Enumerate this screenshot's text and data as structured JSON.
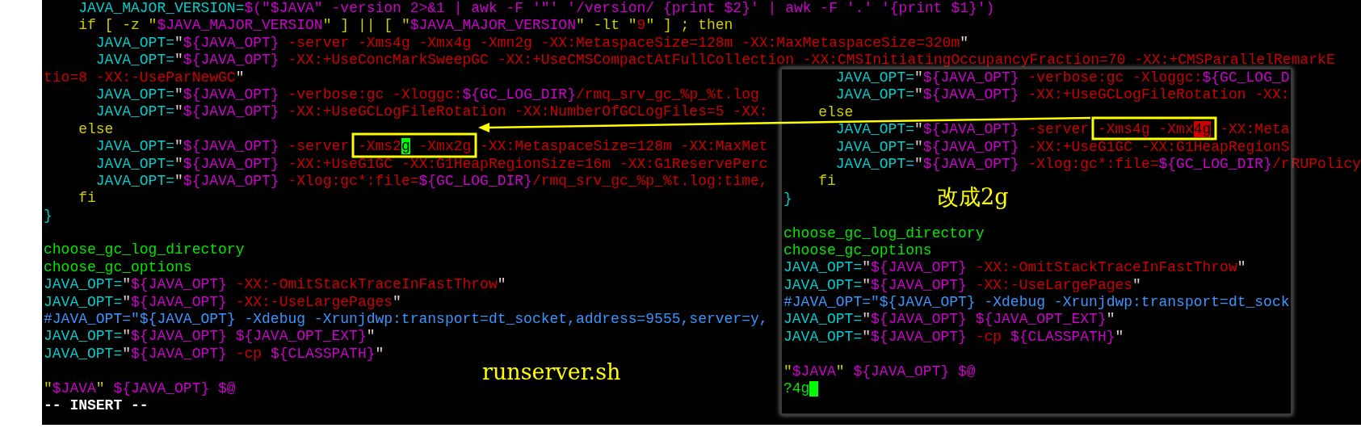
{
  "editor": {
    "lines": [
      {
        "kind": "code",
        "segments": [
          {
            "kind": "variable",
            "text": "    JAVA_MAJOR_VERSION="
          },
          {
            "kind": "expansion",
            "text": "$(\"$JAVA\" -version 2>&1 | awk -F '\"' '/version/ {print $2}' | awk -F '.' '{print $1}')"
          }
        ]
      },
      {
        "kind": "code",
        "segments": [
          {
            "kind": "keyword",
            "text": "    if [ -z \""
          },
          {
            "kind": "expansion",
            "text": "$JAVA_MAJOR_VERSION"
          },
          {
            "kind": "keyword",
            "text": "\" ] || [ \""
          },
          {
            "kind": "expansion",
            "text": "$JAVA_MAJOR_VERSION"
          },
          {
            "kind": "keyword",
            "text": "\" -lt \""
          },
          {
            "kind": "option",
            "text": "9"
          },
          {
            "kind": "keyword",
            "text": "\" ] ; then"
          }
        ]
      },
      {
        "kind": "code",
        "segments": [
          {
            "kind": "variable",
            "text": "      JAVA_OPT="
          },
          {
            "kind": "quote",
            "text": "\""
          },
          {
            "kind": "expansion",
            "text": "${JAVA_OPT}"
          },
          {
            "kind": "option",
            "text": " -server -Xms4g -Xmx4g -Xmn2g -XX:MetaspaceSize=128m -XX:MaxMetaspaceSize=320m"
          },
          {
            "kind": "quote",
            "text": "\""
          }
        ]
      },
      {
        "kind": "code",
        "segments": [
          {
            "kind": "variable",
            "text": "      JAVA_OPT="
          },
          {
            "kind": "quote",
            "text": "\""
          },
          {
            "kind": "expansion",
            "text": "${JAVA_OPT}"
          },
          {
            "kind": "option",
            "text": " -XX:+UseConcMarkSweepGC -XX:+UseCMSCompactAtFullCollection -XX:CMSInitiatingOccupancyFraction=70 -XX:+CMSParallelRemarkE"
          }
        ]
      },
      {
        "kind": "code",
        "segments": [
          {
            "kind": "option",
            "text": "tio=8 -XX:-UseParNewGC"
          },
          {
            "kind": "quote",
            "text": "\""
          }
        ]
      },
      {
        "kind": "code",
        "segments": [
          {
            "kind": "variable",
            "text": "      JAVA_OPT="
          },
          {
            "kind": "quote",
            "text": "\""
          },
          {
            "kind": "expansion",
            "text": "${JAVA_OPT}"
          },
          {
            "kind": "option",
            "text": " -verbose:gc -Xloggc:"
          },
          {
            "kind": "expansion",
            "text": "${GC_LOG_DIR}"
          },
          {
            "kind": "option",
            "text": "/rmq_srv_gc_%p_%t.log"
          }
        ]
      },
      {
        "kind": "code",
        "segments": [
          {
            "kind": "variable",
            "text": "      JAVA_OPT="
          },
          {
            "kind": "quote",
            "text": "\""
          },
          {
            "kind": "expansion",
            "text": "${JAVA_OPT}"
          },
          {
            "kind": "option",
            "text": " -XX:+UseGCLogFileRotation -XX:NumberOfGCLogFiles=5 -XX:"
          }
        ]
      },
      {
        "kind": "code",
        "segments": [
          {
            "kind": "keyword",
            "text": "    else"
          }
        ]
      },
      {
        "kind": "code",
        "segments": [
          {
            "kind": "variable",
            "text": "      JAVA_OPT="
          },
          {
            "kind": "quote",
            "text": "\""
          },
          {
            "kind": "expansion",
            "text": "${JAVA_OPT}"
          },
          {
            "kind": "option",
            "text": " -server -Xms2"
          },
          {
            "kind": "cursor",
            "text": "g"
          },
          {
            "kind": "option",
            "text": " -Xmx2g -XX:MetaspaceSize=128m -XX:MaxMet"
          }
        ]
      },
      {
        "kind": "code",
        "segments": [
          {
            "kind": "variable",
            "text": "      JAVA_OPT="
          },
          {
            "kind": "quote",
            "text": "\""
          },
          {
            "kind": "expansion",
            "text": "${JAVA_OPT}"
          },
          {
            "kind": "option",
            "text": " -XX:+UseG1GC -XX:G1HeapRegionSize=16m -XX:G1ReservePerc"
          }
        ],
        "right_text": "RUPolicy"
      },
      {
        "kind": "code",
        "segments": [
          {
            "kind": "variable",
            "text": "      JAVA_OPT="
          },
          {
            "kind": "quote",
            "text": "\""
          },
          {
            "kind": "expansion",
            "text": "${JAVA_OPT}"
          },
          {
            "kind": "option",
            "text": " -Xlog:gc*:file="
          },
          {
            "kind": "expansion",
            "text": "${GC_LOG_DIR}"
          },
          {
            "kind": "option",
            "text": "/rmq_srv_gc_%p_%t.log:time,"
          }
        ]
      },
      {
        "kind": "code",
        "segments": [
          {
            "kind": "keyword",
            "text": "    fi"
          }
        ]
      },
      {
        "kind": "code",
        "segments": [
          {
            "kind": "variable",
            "text": "}"
          }
        ]
      },
      {
        "kind": "blank"
      },
      {
        "kind": "code",
        "segments": [
          {
            "kind": "function",
            "text": "choose_gc_log_directory"
          }
        ]
      },
      {
        "kind": "code",
        "segments": [
          {
            "kind": "function",
            "text": "choose_gc_options"
          }
        ]
      },
      {
        "kind": "code",
        "segments": [
          {
            "kind": "variable",
            "text": "JAVA_OPT="
          },
          {
            "kind": "quote",
            "text": "\""
          },
          {
            "kind": "expansion",
            "text": "${JAVA_OPT}"
          },
          {
            "kind": "option",
            "text": " -XX:-OmitStackTraceInFastThrow"
          },
          {
            "kind": "quote",
            "text": "\""
          }
        ]
      },
      {
        "kind": "code",
        "segments": [
          {
            "kind": "variable",
            "text": "JAVA_OPT="
          },
          {
            "kind": "quote",
            "text": "\""
          },
          {
            "kind": "expansion",
            "text": "${JAVA_OPT}"
          },
          {
            "kind": "option",
            "text": " -XX:-UseLargePages"
          },
          {
            "kind": "quote",
            "text": "\""
          }
        ]
      },
      {
        "kind": "code",
        "segments": [
          {
            "kind": "comment",
            "text": "#JAVA_OPT=\"${JAVA_OPT} -Xdebug -Xrunjdwp:transport=dt_socket,address=9555,server=y,"
          }
        ]
      },
      {
        "kind": "code",
        "segments": [
          {
            "kind": "variable",
            "text": "JAVA_OPT="
          },
          {
            "kind": "quote",
            "text": "\""
          },
          {
            "kind": "expansion",
            "text": "${JAVA_OPT} ${JAVA_OPT_EXT}"
          },
          {
            "kind": "quote",
            "text": "\""
          }
        ]
      },
      {
        "kind": "code",
        "segments": [
          {
            "kind": "variable",
            "text": "JAVA_OPT="
          },
          {
            "kind": "quote",
            "text": "\""
          },
          {
            "kind": "expansion",
            "text": "${JAVA_OPT}"
          },
          {
            "kind": "option",
            "text": " -cp "
          },
          {
            "kind": "expansion",
            "text": "${CLASSPATH}"
          },
          {
            "kind": "quote",
            "text": "\""
          }
        ]
      },
      {
        "kind": "blank"
      },
      {
        "kind": "code",
        "segments": [
          {
            "kind": "keyword",
            "text": "\""
          },
          {
            "kind": "expansion",
            "text": "$JAVA"
          },
          {
            "kind": "keyword",
            "text": "\" "
          },
          {
            "kind": "expansion",
            "text": "${JAVA_OPT} $@"
          }
        ]
      }
    ],
    "mode_line": "-- INSERT --"
  },
  "inset_editor": {
    "lines": [
      {
        "kind": "code",
        "segments": [
          {
            "kind": "variable",
            "text": "      JAVA_OPT="
          },
          {
            "kind": "quote",
            "text": "\""
          },
          {
            "kind": "expansion",
            "text": "${JAVA_OPT}"
          },
          {
            "kind": "option",
            "text": " -verbose:gc -Xloggc:"
          },
          {
            "kind": "expansion",
            "text": "${GC_LOG_D"
          }
        ]
      },
      {
        "kind": "code",
        "segments": [
          {
            "kind": "variable",
            "text": "      JAVA_OPT="
          },
          {
            "kind": "quote",
            "text": "\""
          },
          {
            "kind": "expansion",
            "text": "${JAVA_OPT}"
          },
          {
            "kind": "option",
            "text": " -XX:+UseGCLogFileRotation -XX:"
          }
        ]
      },
      {
        "kind": "code",
        "segments": [
          {
            "kind": "keyword",
            "text": "    else"
          }
        ]
      },
      {
        "kind": "code",
        "segments": [
          {
            "kind": "variable",
            "text": "      JAVA_OPT="
          },
          {
            "kind": "quote",
            "text": "\""
          },
          {
            "kind": "expansion",
            "text": "${JAVA_OPT}"
          },
          {
            "kind": "option",
            "text": " -server -Xms4g -Xmx"
          },
          {
            "kind": "match",
            "text": "4g"
          },
          {
            "kind": "option",
            "text": " -XX:Meta"
          }
        ]
      },
      {
        "kind": "code",
        "segments": [
          {
            "kind": "variable",
            "text": "      JAVA_OPT="
          },
          {
            "kind": "quote",
            "text": "\""
          },
          {
            "kind": "expansion",
            "text": "${JAVA_OPT}"
          },
          {
            "kind": "option",
            "text": " -XX:+UseG1GC -XX:G1HeapRegionS"
          }
        ]
      },
      {
        "kind": "code",
        "segments": [
          {
            "kind": "variable",
            "text": "      JAVA_OPT="
          },
          {
            "kind": "quote",
            "text": "\""
          },
          {
            "kind": "expansion",
            "text": "${JAVA_OPT}"
          },
          {
            "kind": "option",
            "text": " -Xlog:gc*:file="
          },
          {
            "kind": "expansion",
            "text": "${GC_LOG_DIR}"
          },
          {
            "kind": "option",
            "text": "/r"
          }
        ]
      },
      {
        "kind": "code",
        "segments": [
          {
            "kind": "keyword",
            "text": "    fi"
          }
        ]
      },
      {
        "kind": "code",
        "segments": [
          {
            "kind": "variable",
            "text": "}"
          }
        ]
      },
      {
        "kind": "blank"
      },
      {
        "kind": "code",
        "segments": [
          {
            "kind": "function",
            "text": "choose_gc_log_directory"
          }
        ]
      },
      {
        "kind": "code",
        "segments": [
          {
            "kind": "function",
            "text": "choose_gc_options"
          }
        ]
      },
      {
        "kind": "code",
        "segments": [
          {
            "kind": "variable",
            "text": "JAVA_OPT="
          },
          {
            "kind": "quote",
            "text": "\""
          },
          {
            "kind": "expansion",
            "text": "${JAVA_OPT}"
          },
          {
            "kind": "option",
            "text": " -XX:-OmitStackTraceInFastThrow"
          },
          {
            "kind": "quote",
            "text": "\""
          }
        ]
      },
      {
        "kind": "code",
        "segments": [
          {
            "kind": "variable",
            "text": "JAVA_OPT="
          },
          {
            "kind": "quote",
            "text": "\""
          },
          {
            "kind": "expansion",
            "text": "${JAVA_OPT}"
          },
          {
            "kind": "option",
            "text": " -XX:-UseLargePages"
          },
          {
            "kind": "quote",
            "text": "\""
          }
        ]
      },
      {
        "kind": "code",
        "segments": [
          {
            "kind": "comment",
            "text": "#JAVA_OPT=\"${JAVA_OPT} -Xdebug -Xrunjdwp:transport=dt_sock"
          }
        ]
      },
      {
        "kind": "code",
        "segments": [
          {
            "kind": "variable",
            "text": "JAVA_OPT="
          },
          {
            "kind": "quote",
            "text": "\""
          },
          {
            "kind": "expansion",
            "text": "${JAVA_OPT} ${JAVA_OPT_EXT}"
          },
          {
            "kind": "quote",
            "text": "\""
          }
        ]
      },
      {
        "kind": "code",
        "segments": [
          {
            "kind": "variable",
            "text": "JAVA_OPT="
          },
          {
            "kind": "quote",
            "text": "\""
          },
          {
            "kind": "expansion",
            "text": "${JAVA_OPT}"
          },
          {
            "kind": "option",
            "text": " -cp "
          },
          {
            "kind": "expansion",
            "text": "${CLASSPATH}"
          },
          {
            "kind": "quote",
            "text": "\""
          }
        ]
      },
      {
        "kind": "blank"
      },
      {
        "kind": "code",
        "segments": [
          {
            "kind": "keyword",
            "text": "\""
          },
          {
            "kind": "expansion",
            "text": "$JAVA"
          },
          {
            "kind": "keyword",
            "text": "\" "
          },
          {
            "kind": "expansion",
            "text": "${JAVA_OPT} $@"
          }
        ]
      }
    ],
    "command": "?4g"
  },
  "annotations": {
    "file_label": "runserver.sh",
    "change_note": "改成2g"
  }
}
